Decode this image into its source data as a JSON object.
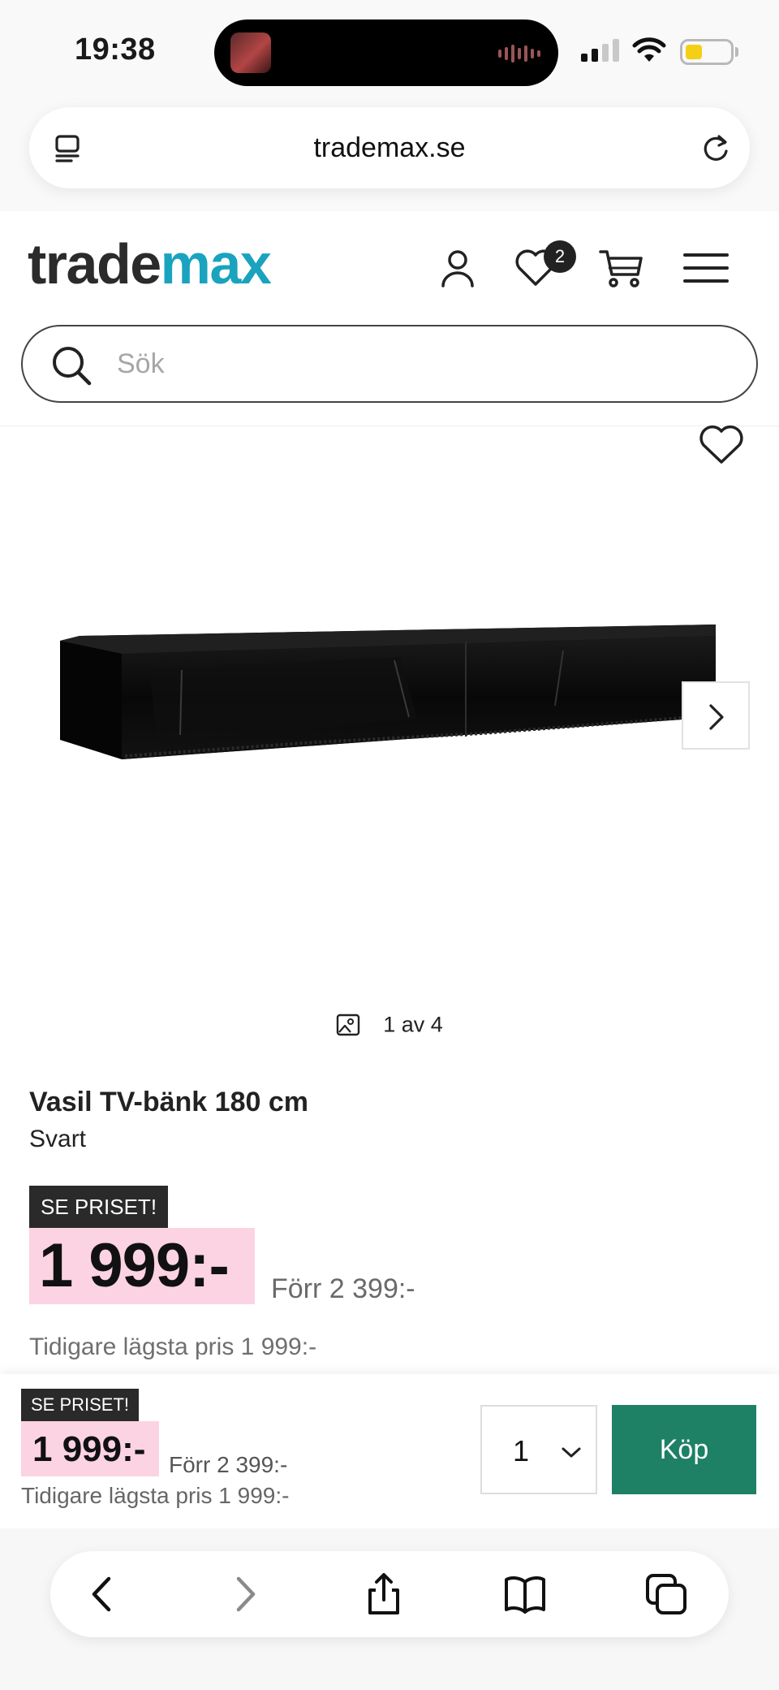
{
  "status_bar": {
    "time": "19:38"
  },
  "browser": {
    "url": "trademax.se"
  },
  "header": {
    "logo_part1": "trade",
    "logo_part2": "max",
    "wishlist_count": "2",
    "search_placeholder": "Sök",
    "brand_color": "#1aa3bf"
  },
  "gallery": {
    "counter": "1 av 4"
  },
  "product": {
    "title": "Vasil TV-bänk 180 cm",
    "color": "Svart",
    "tag": "SE PRISET!",
    "price": "1 999:-",
    "previous_price": "Förr 2 399:-",
    "lowest_price": "Tidigare lägsta pris 1 999:-"
  },
  "buy_bar": {
    "tag": "SE PRISET!",
    "price": "1 999:-",
    "previous_price": "Förr 2 399:-",
    "lowest_price": "Tidigare lägsta pris 1 999:-",
    "quantity": "1",
    "buy_label": "Köp",
    "buy_color": "#1e8065"
  },
  "colors": {
    "price_highlight": "#fcd3e3",
    "tag_bg": "#2a2a2a"
  }
}
